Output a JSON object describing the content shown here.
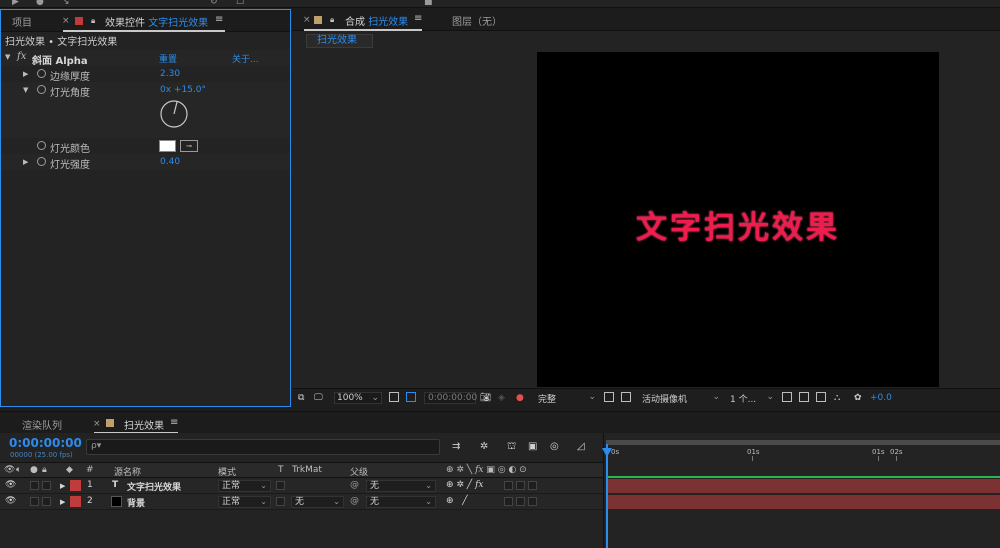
{
  "effect_panel": {
    "tab_project": "项目",
    "tab_effect_prefix": "效果控件",
    "tab_effect_layer": "文字扫光效果",
    "breadcrumb": "扫光效果 • 文字扫光效果",
    "effect_fx": "fx",
    "effect_name": "斜面 Alpha",
    "reset": "重置",
    "about": "关于...",
    "props": [
      {
        "label": "边缘厚度",
        "value": "2.30"
      },
      {
        "label": "灯光角度",
        "value": "0x +15.0°"
      },
      {
        "label": "灯光颜色",
        "value": ""
      },
      {
        "label": "灯光强度",
        "value": "0.40"
      }
    ]
  },
  "comp_panel": {
    "tab_prefix": "合成",
    "tab_name": "扫光效果",
    "layer_tab": "图层（无）",
    "subtab": "扫光效果",
    "canvas_text": "文字扫光效果",
    "zoom": "100%",
    "timecode": "0:00:00:00",
    "resolution": "完整",
    "camera": "活动摄像机",
    "views": "1 个...",
    "exposure": "+0.0"
  },
  "timeline": {
    "tab_render": "渲染队列",
    "tab_comp": "扫光效果",
    "timecode": "0:00:00:00",
    "fps": "00000 (25.00 fps)",
    "search_placeholder": "ρ▾",
    "headers": {
      "number": "#",
      "source": "源名称",
      "mode": "模式",
      "t": "T",
      "trkmat": "TrkMat",
      "parent": "父级"
    },
    "ruler": [
      "0s",
      "01s",
      "01s",
      "02s"
    ],
    "layers": [
      {
        "num": "1",
        "type": "T",
        "name": "文字扫光效果",
        "mode": "正常",
        "trkmat": "",
        "parent": "无",
        "swatch": "#c23b3b",
        "thumb": ""
      },
      {
        "num": "2",
        "type": "",
        "name": "背景",
        "mode": "正常",
        "trkmat": "无",
        "parent": "无",
        "swatch": "#c23b3b",
        "thumb": "#000000"
      }
    ]
  },
  "colors": {
    "accent_blue": "#2d8ceb",
    "comp_text_red": "#ee1d4e",
    "layer_bar": "#7c3232",
    "label_red": "#c23b3b"
  }
}
